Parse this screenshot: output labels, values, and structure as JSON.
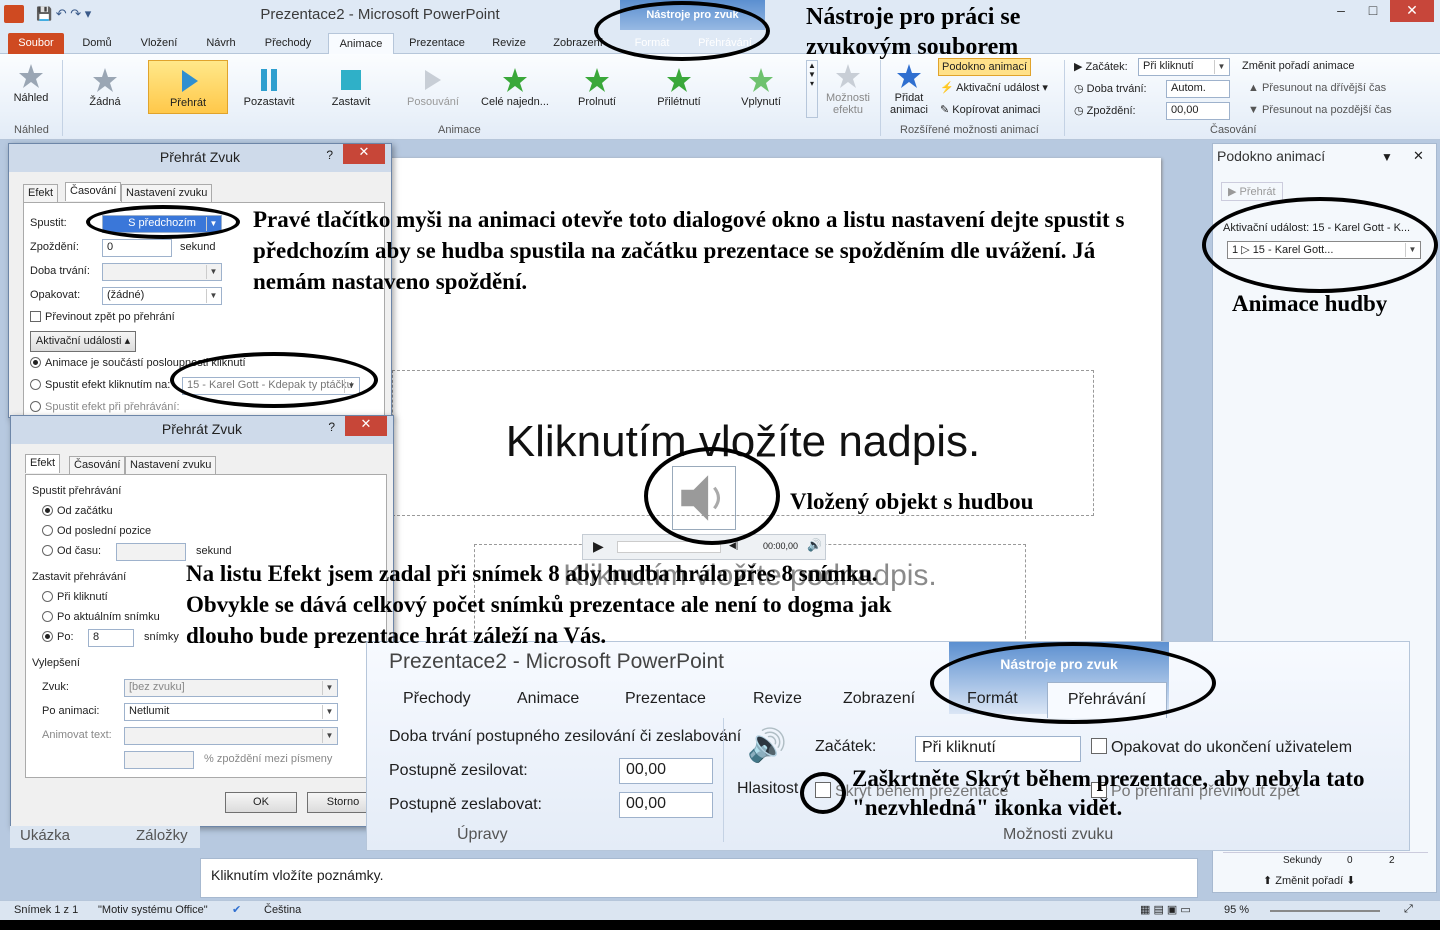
{
  "window": {
    "title": "Prezentace2  -  Microsoft PowerPoint",
    "minimize": "–",
    "maximize": "□",
    "close": "✕"
  },
  "context_tab_group": {
    "label": "Nástroje pro zvuk",
    "tabs": [
      "Formát",
      "Přehrávání"
    ]
  },
  "tabs": [
    "Soubor",
    "Domů",
    "Vložení",
    "Návrh",
    "Přechody",
    "Animace",
    "Prezentace",
    "Revize",
    "Zobrazení"
  ],
  "ribbon": {
    "preview": {
      "label": "Náhled",
      "group": "Náhled"
    },
    "animations": [
      {
        "label": "Žádná"
      },
      {
        "label": "Přehrát"
      },
      {
        "label": "Pozastavit"
      },
      {
        "label": "Zastavit"
      },
      {
        "label": "Posouvání"
      },
      {
        "label": "Celé najedn..."
      },
      {
        "label": "Prolnutí"
      },
      {
        "label": "Přilétnutí"
      },
      {
        "label": "Vplynutí"
      }
    ],
    "effect_options": "Možnosti efektu",
    "animations_group": "Animace",
    "add_animation": "Přidat animaci",
    "animation_pane": "Podokno animací",
    "trigger": "Aktivační událost",
    "painter": "Kopírovat animaci",
    "advanced_group": "Rozšířené možnosti animací",
    "start_label": "Začátek:",
    "start_value": "Při kliknutí",
    "duration_label": "Doba trvání:",
    "duration_value": "Autom.",
    "delay_label": "Zpoždění:",
    "delay_value": "00,00",
    "reorder": "Změnit pořadí animace",
    "earlier": "Přesunout na dřívější čas",
    "later": "Přesunout na pozdější čas",
    "timing_group": "Časování"
  },
  "pane": {
    "title": "Podokno animací",
    "play": "Přehrát",
    "trigger": "Aktivační událost: 15 - Karel Gott - K...",
    "item": "1 ▷  15 - Karel Gott...",
    "seconds": "Sekundy",
    "reorder": "Změnit pořadí",
    "scale_0": "0",
    "scale_2": "2"
  },
  "slide": {
    "title": "Kliknutím vložíte nadpis.",
    "subtitle": "Kliknutím vložíte podnadpis.",
    "time": "00:00,00"
  },
  "dialog1": {
    "title": "Přehrát Zvuk",
    "help": "?",
    "close": "✕",
    "tabs": [
      "Efekt",
      "Časování",
      "Nastavení zvuku"
    ],
    "start_label": "Spustit:",
    "start_value": "S předchozím",
    "delay_label": "Zpoždění:",
    "delay_value": "0",
    "delay_unit": "sekund",
    "duration_label": "Doba trvání:",
    "repeat_label": "Opakovat:",
    "repeat_value": "(žádné)",
    "rewind": "Převinout zpět po přehrání",
    "triggers_btn": "Aktivační události",
    "opt1": "Animace je součástí posloupnosti kliknutí",
    "opt2": "Spustit efekt kliknutím na:",
    "opt2_value": "15 - Karel Gott - Kdepak ty ptáčku",
    "opt3": "Spustit efekt při přehrávání:"
  },
  "dialog2": {
    "title": "Přehrát Zvuk",
    "help": "?",
    "close": "✕",
    "tabs": [
      "Efekt",
      "Časování",
      "Nastavení zvuku"
    ],
    "start_section": "Spustit přehrávání",
    "from_start": "Od začátku",
    "from_last": "Od poslední pozice",
    "from_time": "Od času:",
    "sec": "sekund",
    "stop_section": "Zastavit přehrávání",
    "on_click": "Při kliknutí",
    "after_current": "Po aktuálním snímku",
    "after": "Po:",
    "after_value": "8",
    "slides": "snímky",
    "enh_section": "Vylepšení",
    "sound_label": "Zvuk:",
    "sound_value": "[bez zvuku]",
    "after_anim_label": "Po animaci:",
    "after_anim_value": "Netlumit",
    "animate_text_label": "Animovat text:",
    "percent": "% zpoždění mezi písmeny",
    "ok": "OK",
    "cancel": "Storno"
  },
  "zoomed": {
    "title": "Prezentace2  -  Microsoft PowerPoint",
    "context": "Nástroje pro zvuk",
    "tabs": [
      "Přechody",
      "Animace",
      "Prezentace",
      "Revize",
      "Zobrazení",
      "Formát",
      "Přehrávání"
    ],
    "fade": "Doba trvání postupného zesilování či zeslabování",
    "fade_in": "Postupně zesilovat:",
    "fade_out": "Postupně zeslabovat:",
    "fade_in_val": "00,00",
    "fade_out_val": "00,00",
    "edit_group": "Úpravy",
    "volume": "Hlasitost",
    "start": "Začátek:",
    "start_value": "Při kliknutí",
    "loop": "Opakovat do ukončení uživatelem",
    "hide": "Skrýt během prezentace",
    "rewind": "Po přehrání převinout zpět",
    "options_group": "Možnosti zvuku"
  },
  "bottom_tabs": {
    "outline": "Ukázka",
    "slides": "Záložky"
  },
  "notes": "Kliknutím vložíte poznámky.",
  "status": {
    "slide": "Snímek 1 z 1",
    "theme": "\"Motiv systému Office\"",
    "lang": "Čeština",
    "zoom": "95 %"
  },
  "annotations": {
    "a1": "Nástroje pro práci se zvukovým souborem",
    "a2": "Pravé tlačítko myši na animaci otevře toto dialogové okno a listu nastavení dejte spustit s předchozím aby se hudba spustila na začátku prezentace se spožděním dle uvážení. Já nemám nastaveno spoždění.",
    "a3": "Animace hudby",
    "a4": "Vložený objekt s hudbou",
    "a5": "Na listu Efekt jsem zadal při snímek 8 aby hudba hrála přes 8 snímku. Obvykle se dává celkový počet snímků prezentace ale není to  dogma jak dlouho bude prezentace hrát záleží na Vás.",
    "a6": "Zaškrtněte Skrýt během prezentace, aby nebyla tato \"nezvhledná\" ikonka vidět."
  },
  "colors": {
    "accent": "#cf4a21",
    "selected": "#ffc84a",
    "context": "#5b8fd0"
  }
}
